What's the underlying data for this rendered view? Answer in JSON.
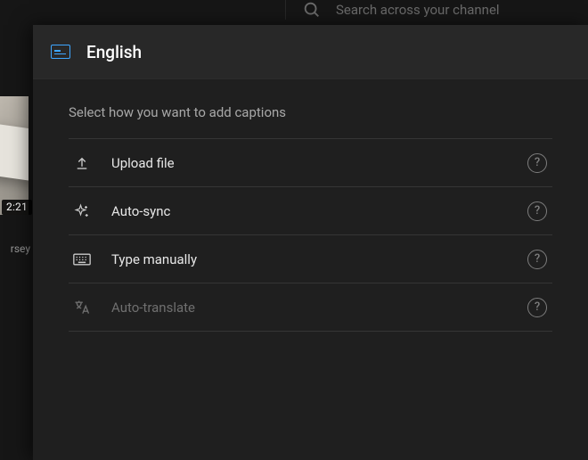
{
  "background": {
    "search_placeholder": "Search across your channel",
    "thumb_duration": "2:21",
    "thumb_caption_fragment": "rsey"
  },
  "dialog": {
    "title": "English",
    "prompt": "Select how you want to add captions",
    "options": [
      {
        "id": "upload",
        "label": "Upload file",
        "icon": "upload-icon",
        "disabled": false
      },
      {
        "id": "autosync",
        "label": "Auto-sync",
        "icon": "sparkle-icon",
        "disabled": false
      },
      {
        "id": "manual",
        "label": "Type manually",
        "icon": "keyboard-icon",
        "disabled": false
      },
      {
        "id": "translate",
        "label": "Auto-translate",
        "icon": "translate-icon",
        "disabled": true
      }
    ],
    "help_glyph": "?"
  }
}
